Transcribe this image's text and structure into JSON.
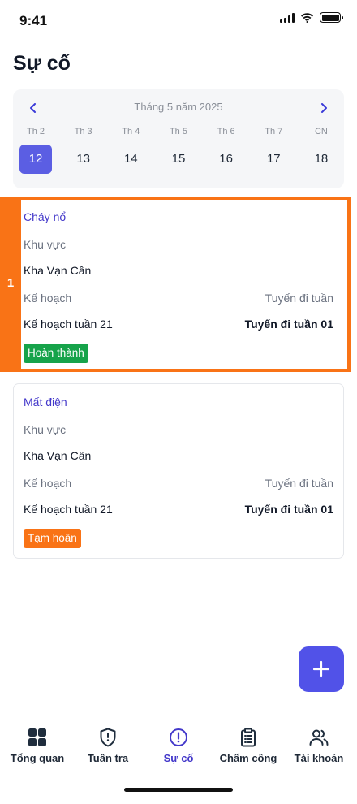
{
  "status_bar": {
    "time": "9:41"
  },
  "page": {
    "title": "Sự cố"
  },
  "calendar": {
    "month_label": "Tháng 5 năm 2025",
    "days": [
      {
        "dow": "Th 2",
        "date": "12",
        "selected": true
      },
      {
        "dow": "Th 3",
        "date": "13"
      },
      {
        "dow": "Th 4",
        "date": "14"
      },
      {
        "dow": "Th 5",
        "date": "15"
      },
      {
        "dow": "Th 6",
        "date": "16"
      },
      {
        "dow": "Th 7",
        "date": "17"
      },
      {
        "dow": "CN",
        "date": "18"
      }
    ]
  },
  "incidents": [
    {
      "type": "Cháy nổ",
      "area_label": "Khu vực",
      "area_value": "Kha Vạn Cân",
      "plan_label": "Kế hoạch",
      "route_label": "Tuyến đi tuần",
      "plan_value": "Kế hoạch tuần 21",
      "route_value": "Tuyến đi tuần 01",
      "status": "Hoàn thành",
      "status_color": "#16a34a"
    },
    {
      "type": "Mất điện",
      "area_label": "Khu vực",
      "area_value": "Kha Vạn Cân",
      "plan_label": "Kế hoạch",
      "route_label": "Tuyến đi tuần",
      "plan_value": "Kế hoạch tuần 21",
      "route_value": "Tuyến đi tuần 01",
      "status": "Tạm hoãn",
      "status_color": "#f97316"
    }
  ],
  "highlight": {
    "number": "1",
    "color": "#f97316"
  },
  "accent_color": "#5152e8",
  "bottom_nav": [
    {
      "label": "Tổng quan",
      "icon": "grid-icon"
    },
    {
      "label": "Tuần tra",
      "icon": "shield-icon"
    },
    {
      "label": "Sự cố",
      "icon": "alert-circle-icon",
      "active": true
    },
    {
      "label": "Chấm công",
      "icon": "clipboard-icon"
    },
    {
      "label": "Tài khoản",
      "icon": "users-icon"
    }
  ]
}
